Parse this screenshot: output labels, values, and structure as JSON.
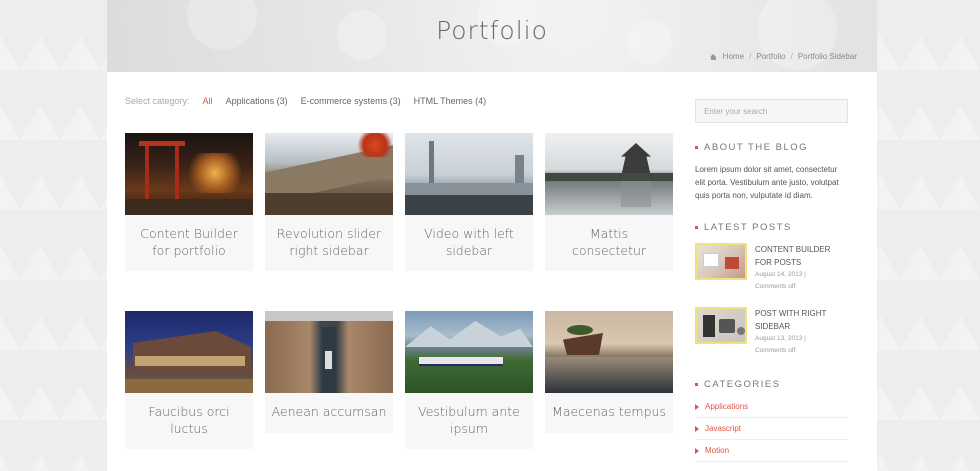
{
  "header": {
    "title": "Portfolio",
    "breadcrumb": [
      "Home",
      "Portfolio",
      "Portfolio Sidebar"
    ]
  },
  "filters": {
    "label": "Select category:",
    "options": [
      "All",
      "Applications (3)",
      "E-commerce systems (3)",
      "HTML Themes (4)"
    ],
    "active": "All"
  },
  "portfolio": {
    "items": [
      {
        "title": "Content Builder for portfolio",
        "image": "japanese-shrine-night"
      },
      {
        "title": "Revolution slider right sidebar",
        "image": "great-wall"
      },
      {
        "title": "Video with left sidebar",
        "image": "city-skyline"
      },
      {
        "title": "Mattis consectetur",
        "image": "japanese-castle-lake"
      },
      {
        "title": "Faucibus orci luctus",
        "image": "modern-building-dusk"
      },
      {
        "title": "Aenean accumsan",
        "image": "canal-gorge"
      },
      {
        "title": "Vestibulum ante ipsum",
        "image": "train-mountains"
      },
      {
        "title": "Maecenas tempus",
        "image": "shipwreck-sunset"
      }
    ]
  },
  "sidebar": {
    "search_placeholder": "Enter your search",
    "about": {
      "heading": "About the blog",
      "text": "Lorem ipsum dolor sit amet, consectetur elit porta. Vestibulum ante justo, volutpat quis porta non, vulputate id diam."
    },
    "latest": {
      "heading": "Latest posts",
      "posts": [
        {
          "title": "Content builder for posts",
          "date": "August 14, 2013 |",
          "comments": "Comments off",
          "image": "desk-photo"
        },
        {
          "title": "Post with right sidebar",
          "date": "August 13, 2013 |",
          "comments": "Comments off",
          "image": "gadgets-photo"
        }
      ]
    },
    "categories": {
      "heading": "Categories",
      "items": [
        "Applications",
        "Javascript",
        "Motion"
      ]
    }
  },
  "colors": {
    "accent": "#e0534a",
    "thumb_border": "#f1e27a"
  }
}
